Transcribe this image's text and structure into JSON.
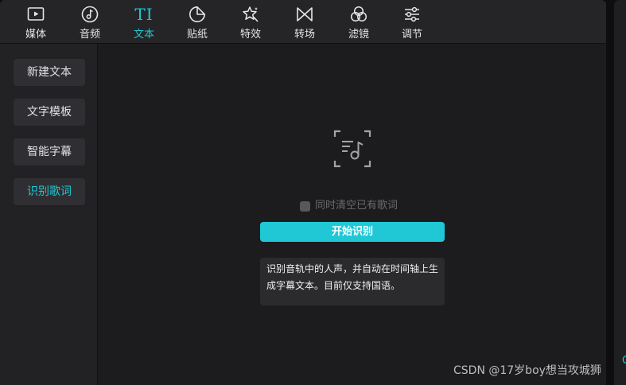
{
  "toolbar": {
    "items": [
      {
        "label": "媒体",
        "icon": "media-icon"
      },
      {
        "label": "音频",
        "icon": "audio-icon"
      },
      {
        "label": "文本",
        "icon": "text-icon",
        "icon_text": "TI",
        "active": true
      },
      {
        "label": "贴纸",
        "icon": "sticker-icon"
      },
      {
        "label": "特效",
        "icon": "effects-icon"
      },
      {
        "label": "转场",
        "icon": "transition-icon"
      },
      {
        "label": "滤镜",
        "icon": "filter-icon"
      },
      {
        "label": "调节",
        "icon": "adjust-icon"
      }
    ]
  },
  "left_menu": {
    "items": [
      {
        "label": "新建文本"
      },
      {
        "label": "文字模板"
      },
      {
        "label": "智能字幕"
      },
      {
        "label": "识别歌词",
        "active": true
      }
    ]
  },
  "main": {
    "icon": "lyrics-recognize-icon",
    "clear_option_label": "同时清空已有歌词",
    "start_button_label": "开始识别",
    "info_text": "识别音轨中的人声，并自动在时间轴上生成字幕文本。目前仅支持国语。"
  },
  "side_panel": {
    "visible_char": "C"
  },
  "watermark": "CSDN @17岁boy想当攻城狮",
  "colors": {
    "accent": "#1fc8d4",
    "panel_bg": "#1c1c1e",
    "toolbar_bg": "#252528",
    "button_bg": "#2f2f33"
  }
}
